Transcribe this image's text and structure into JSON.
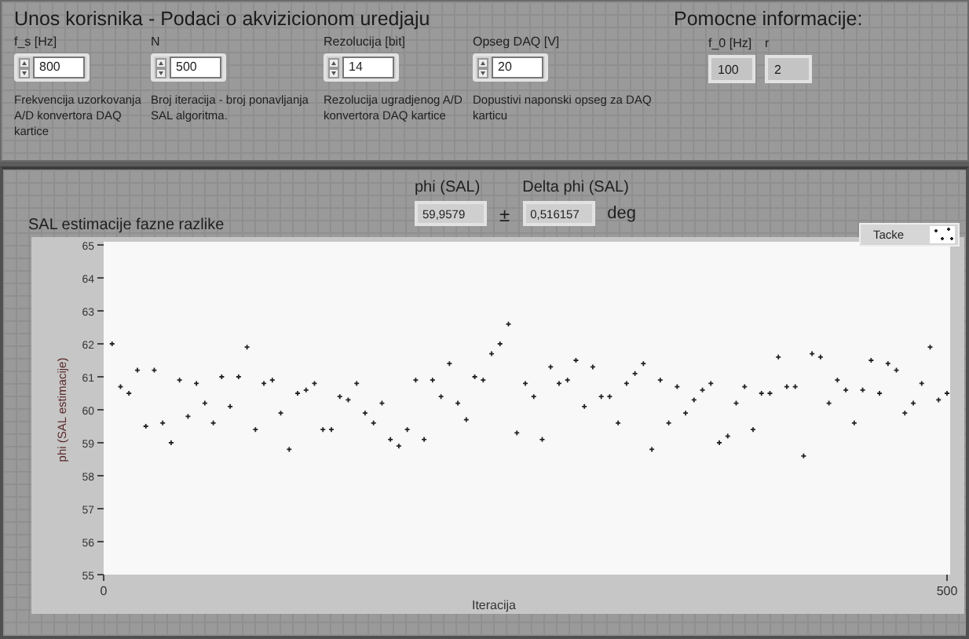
{
  "user_input": {
    "title": "Unos korisnika - Podaci o akvizicionom uredjaju",
    "controls": [
      {
        "label": "f_s [Hz]",
        "value": "800",
        "description": "Frekvencija uzorkovanja A/D konvertora DAQ kartice"
      },
      {
        "label": "N",
        "value": "500",
        "description": "Broj iteracija - broj ponavljanja SAL algoritma."
      },
      {
        "label": "Rezolucija [bit]",
        "value": "14",
        "description": "Rezolucija ugradjenog A/D konvertora DAQ kartice"
      },
      {
        "label": "Opseg DAQ [V]",
        "value": "20",
        "description": "Dopustivi naponski opseg za DAQ karticu"
      }
    ]
  },
  "helper_info": {
    "title": "Pomocne informacije:",
    "indicators": [
      {
        "label": "f_0 [Hz]",
        "value": "100"
      },
      {
        "label": "r",
        "value": "2"
      }
    ]
  },
  "results": {
    "phi": {
      "label": "phi (SAL)",
      "value": "59,9579"
    },
    "separator": "±",
    "delta": {
      "label": "Delta phi (SAL)",
      "value": "0,516157"
    },
    "unit": "deg"
  },
  "graph": {
    "title": "SAL estimacije fazne razlike",
    "chart_data": {
      "type": "scatter",
      "xlabel": "Iteracija",
      "ylabel": "phi (SAL estimacije)",
      "xlim": [
        0,
        500
      ],
      "ylim": [
        55,
        65
      ],
      "xticks": [
        0,
        500
      ],
      "yticks": [
        55,
        56,
        57,
        58,
        59,
        60,
        61,
        62,
        63,
        64,
        65
      ],
      "x": [
        5,
        10,
        15,
        20,
        25,
        30,
        35,
        40,
        45,
        50,
        55,
        60,
        65,
        70,
        75,
        80,
        85,
        90,
        95,
        100,
        105,
        110,
        115,
        120,
        125,
        130,
        135,
        140,
        145,
        150,
        155,
        160,
        165,
        170,
        175,
        180,
        185,
        190,
        195,
        200,
        205,
        210,
        215,
        220,
        225,
        230,
        235,
        240,
        245,
        250,
        255,
        260,
        265,
        270,
        275,
        280,
        285,
        290,
        295,
        300,
        305,
        310,
        315,
        320,
        325,
        330,
        335,
        340,
        345,
        350,
        355,
        360,
        365,
        370,
        375,
        380,
        385,
        390,
        395,
        400,
        405,
        410,
        415,
        420,
        425,
        430,
        435,
        440,
        445,
        450,
        455,
        460,
        465,
        470,
        475,
        480,
        485,
        490,
        495,
        500
      ],
      "series": [
        {
          "name": "Tacke",
          "values": [
            62.0,
            60.7,
            60.5,
            61.2,
            59.5,
            61.2,
            59.6,
            59.0,
            60.9,
            59.8,
            60.8,
            60.2,
            59.6,
            61.0,
            60.1,
            61.0,
            61.9,
            59.4,
            60.8,
            60.9,
            59.9,
            58.8,
            60.5,
            60.6,
            60.8,
            59.4,
            59.4,
            60.4,
            60.3,
            60.8,
            59.9,
            59.6,
            60.2,
            59.1,
            58.9,
            59.4,
            60.9,
            59.1,
            60.9,
            60.4,
            61.4,
            60.2,
            59.7,
            61.0,
            60.9,
            61.7,
            62.0,
            62.6,
            59.3,
            60.8,
            60.4,
            59.1,
            61.3,
            60.8,
            60.9,
            61.5,
            60.1,
            61.3,
            60.4,
            60.4,
            59.6,
            60.8,
            61.1,
            61.4,
            58.8,
            60.9,
            59.6,
            60.7,
            59.9,
            60.3,
            60.6,
            60.8,
            59.0,
            59.2,
            60.2,
            60.7,
            59.4,
            60.5,
            60.5,
            61.6,
            60.7,
            60.7,
            58.6,
            61.7,
            61.6,
            60.2,
            60.9,
            60.6,
            59.6,
            60.6,
            61.5,
            60.5,
            61.4,
            61.2,
            59.9,
            60.2,
            60.8,
            61.9,
            60.3,
            60.5
          ]
        }
      ]
    }
  }
}
